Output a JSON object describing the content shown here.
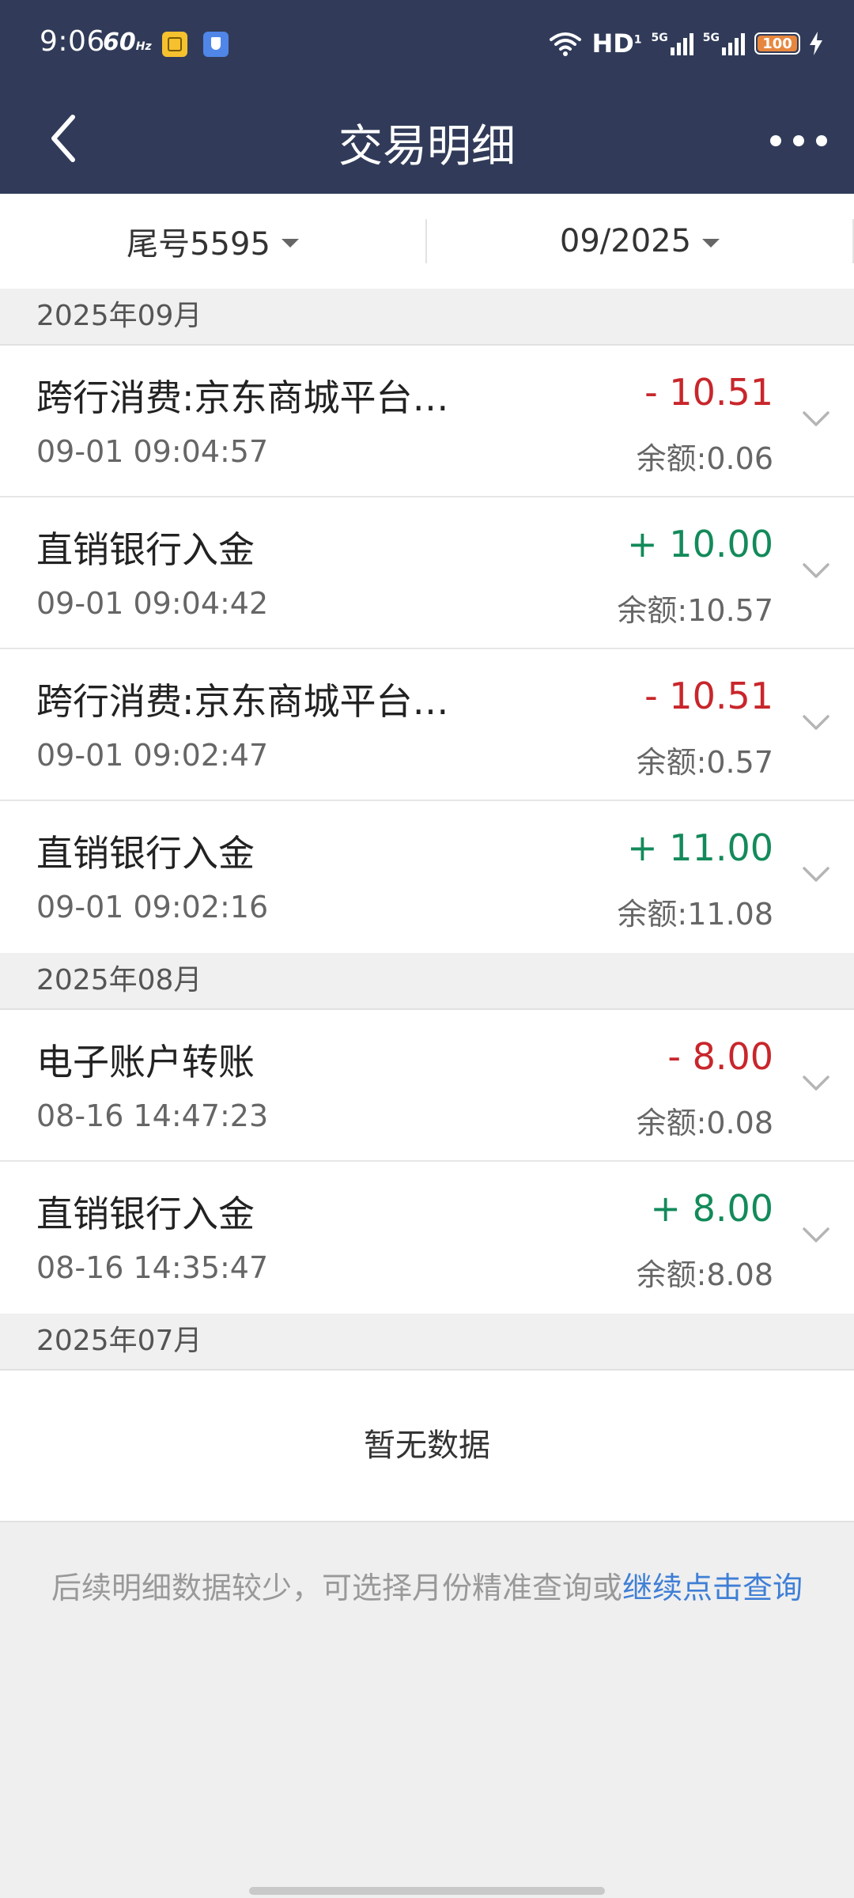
{
  "status_bar": {
    "time": "9:06",
    "refresh_rate": "60",
    "refresh_unit": "Hz",
    "network": "HD",
    "network_sup": "1",
    "sim1": "5G",
    "sim2": "5G",
    "battery": "100",
    "battery_level": 1.0,
    "battery_color": "#e7873e"
  },
  "header": {
    "title": "交易明细",
    "back_icon": "chevron-left-icon",
    "more_icon": "more-horizontal-icon",
    "background": "#313b59"
  },
  "filters": {
    "account": "尾号5595",
    "month": "09/2025"
  },
  "groups": [
    {
      "month": "2025年09月",
      "items": [
        {
          "title": "跨行消费:京东商城平台…",
          "time": "09-01 09:04:57",
          "amount": "- 10.51",
          "balance": "余额:0.06",
          "direction": "neg"
        },
        {
          "title": "直销银行入金",
          "time": "09-01 09:04:42",
          "amount": "+ 10.00",
          "balance": "余额:10.57",
          "direction": "pos"
        },
        {
          "title": "跨行消费:京东商城平台…",
          "time": "09-01 09:02:47",
          "amount": "- 10.51",
          "balance": "余额:0.57",
          "direction": "neg"
        },
        {
          "title": "直销银行入金",
          "time": "09-01 09:02:16",
          "amount": "+ 11.00",
          "balance": "余额:11.08",
          "direction": "pos"
        }
      ]
    },
    {
      "month": "2025年08月",
      "items": [
        {
          "title": "电子账户转账",
          "time": "08-16 14:47:23",
          "amount": "- 8.00",
          "balance": "余额:0.08",
          "direction": "neg"
        },
        {
          "title": "直销银行入金",
          "time": "08-16 14:35:47",
          "amount": "+ 8.00",
          "balance": "余额:8.08",
          "direction": "pos"
        }
      ]
    },
    {
      "month": "2025年07月",
      "empty_text": "暂无数据"
    }
  ],
  "footer": {
    "note": "后续明细数据较少，可选择月份精准查询或",
    "link": "继续点击查询"
  },
  "colors": {
    "negative": "#c8262b",
    "positive": "#138a5a",
    "link": "#3f7fd6"
  }
}
